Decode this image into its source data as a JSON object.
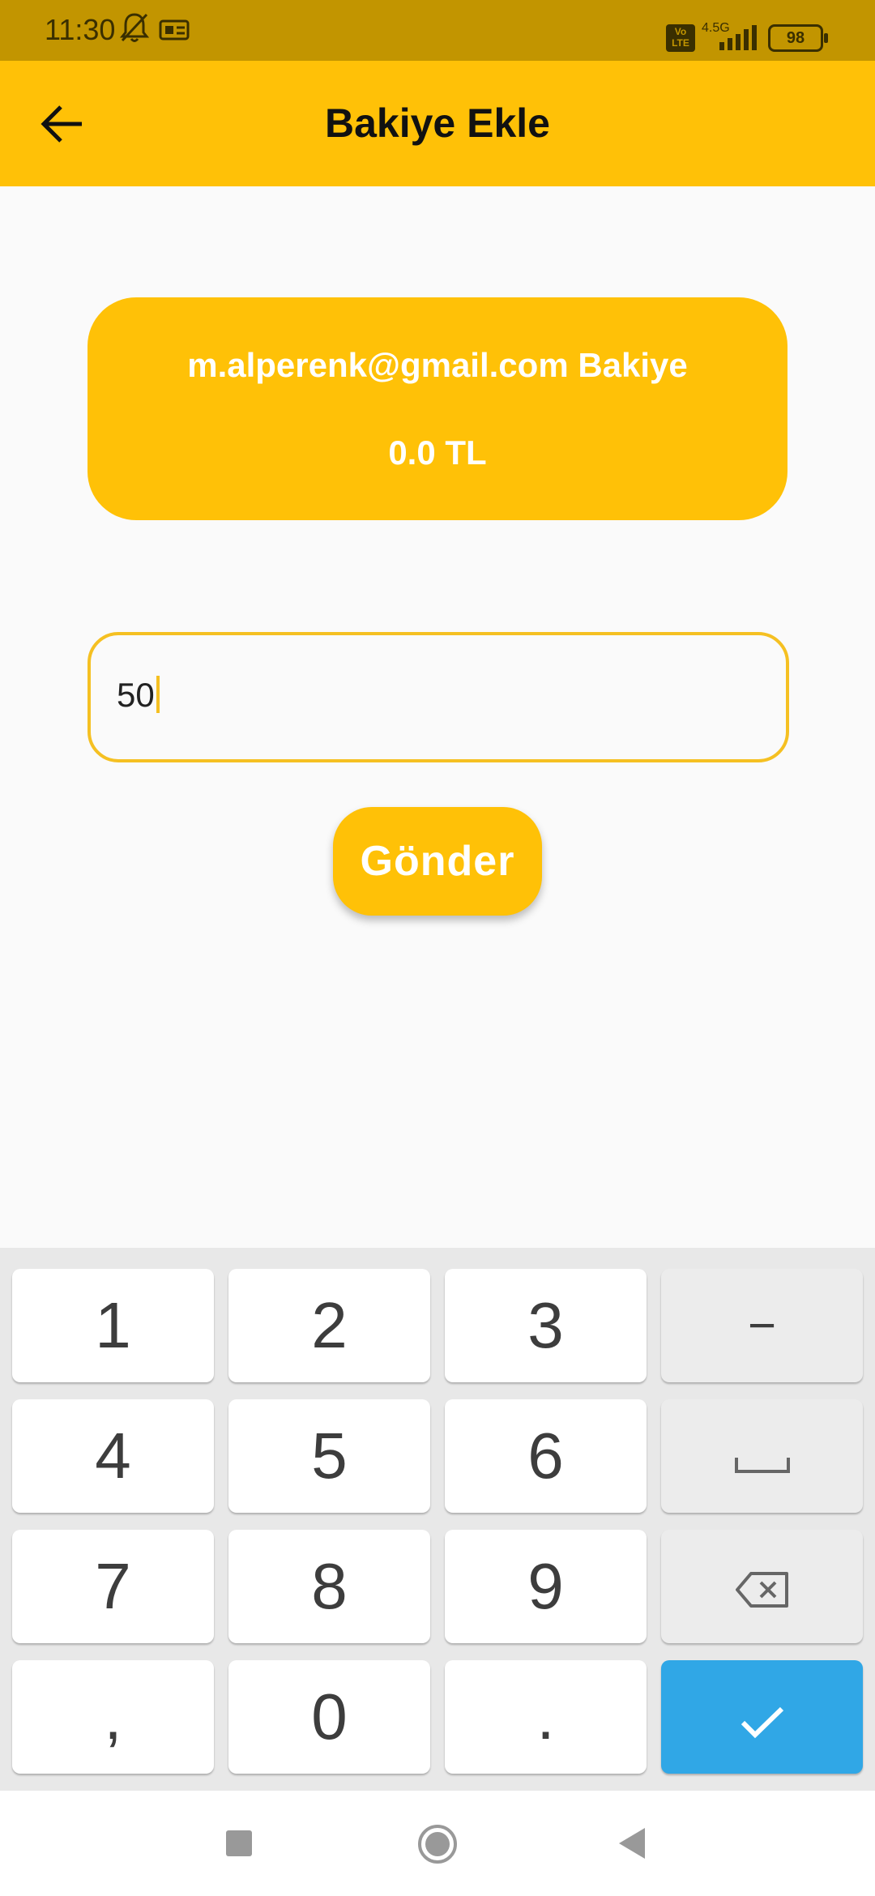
{
  "status_bar": {
    "time": "11:30",
    "network": "4.5G",
    "volte": "Vo LTE",
    "battery": "98"
  },
  "app_bar": {
    "title": "Bakiye Ekle"
  },
  "balance_card": {
    "email_label": "m.alperenk@gmail.com Bakiye",
    "amount": "0.0 TL"
  },
  "amount_input": {
    "value": "50"
  },
  "send_button": {
    "label": "Gönder"
  },
  "keyboard": {
    "keys": [
      "1",
      "2",
      "3",
      "−",
      "4",
      "5",
      "6",
      "␣",
      "7",
      "8",
      "9",
      "⌫",
      ",",
      "0",
      ".",
      "✓"
    ]
  },
  "colors": {
    "primary": "#ffc107",
    "status_bar": "#c29500",
    "confirm_key": "#30a7e6",
    "background": "#fafafa"
  }
}
